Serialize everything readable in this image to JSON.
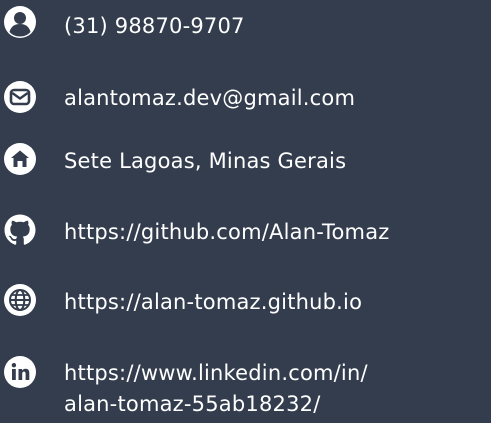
{
  "contacts": {
    "phone": {
      "text": "(31) 98870-9707",
      "icon": "user-icon"
    },
    "email": {
      "text": "alantomaz.dev@gmail.com",
      "icon": "envelope-icon"
    },
    "address": {
      "text": "Sete Lagoas, Minas Gerais",
      "icon": "home-icon"
    },
    "github": {
      "text": "https://github.com/Alan-Tomaz",
      "icon": "github-icon"
    },
    "website": {
      "text": "https://alan-tomaz.github.io",
      "icon": "globe-icon"
    },
    "linkedin": {
      "line1": "https://www.linkedin.com/in/",
      "line2": "alan-tomaz-55ab18232/",
      "icon": "linkedin-icon"
    }
  },
  "colors": {
    "background": "#333d4d",
    "foreground": "#ffffff"
  }
}
